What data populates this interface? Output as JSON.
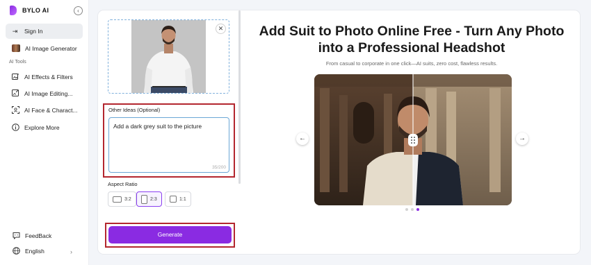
{
  "brand": {
    "name": "BYLO AI"
  },
  "sidebar": {
    "sign_in": "Sign In",
    "items": [
      {
        "label": "AI Image Generator",
        "icon": "image-thumbnail-icon"
      },
      {
        "label": "AI Effects & Filters",
        "icon": "sparkle-image-icon"
      },
      {
        "label": "AI Image Editing...",
        "icon": "edit-image-icon"
      },
      {
        "label": "AI Face & Charact...",
        "icon": "face-scan-icon"
      },
      {
        "label": "Explore More",
        "icon": "info-circle-icon"
      }
    ],
    "section_label": "AI Tools",
    "feedback": "FeedBack",
    "language": "English"
  },
  "form": {
    "ideas_label": "Other Ideas (Optional)",
    "ideas_value": "Add a dark grey suit to the picture",
    "char_count": "35/200",
    "aspect_label": "Aspect Ratio",
    "ratios": [
      {
        "label": "3:2",
        "selected": false
      },
      {
        "label": "2:3",
        "selected": true
      },
      {
        "label": "1:1",
        "selected": false
      }
    ],
    "generate_label": "Generate"
  },
  "hero": {
    "title": "Add Suit to Photo Online Free - Turn Any Photo into a Professional Headshot",
    "subtitle": "From casual to corporate in one click—AI suits, zero cost, flawless results."
  },
  "carousel": {
    "page_count": 3,
    "active_page": 3
  },
  "colors": {
    "accent": "#8a2be2",
    "highlight_frame": "#b3262e",
    "input_border": "#6aa6d6"
  }
}
